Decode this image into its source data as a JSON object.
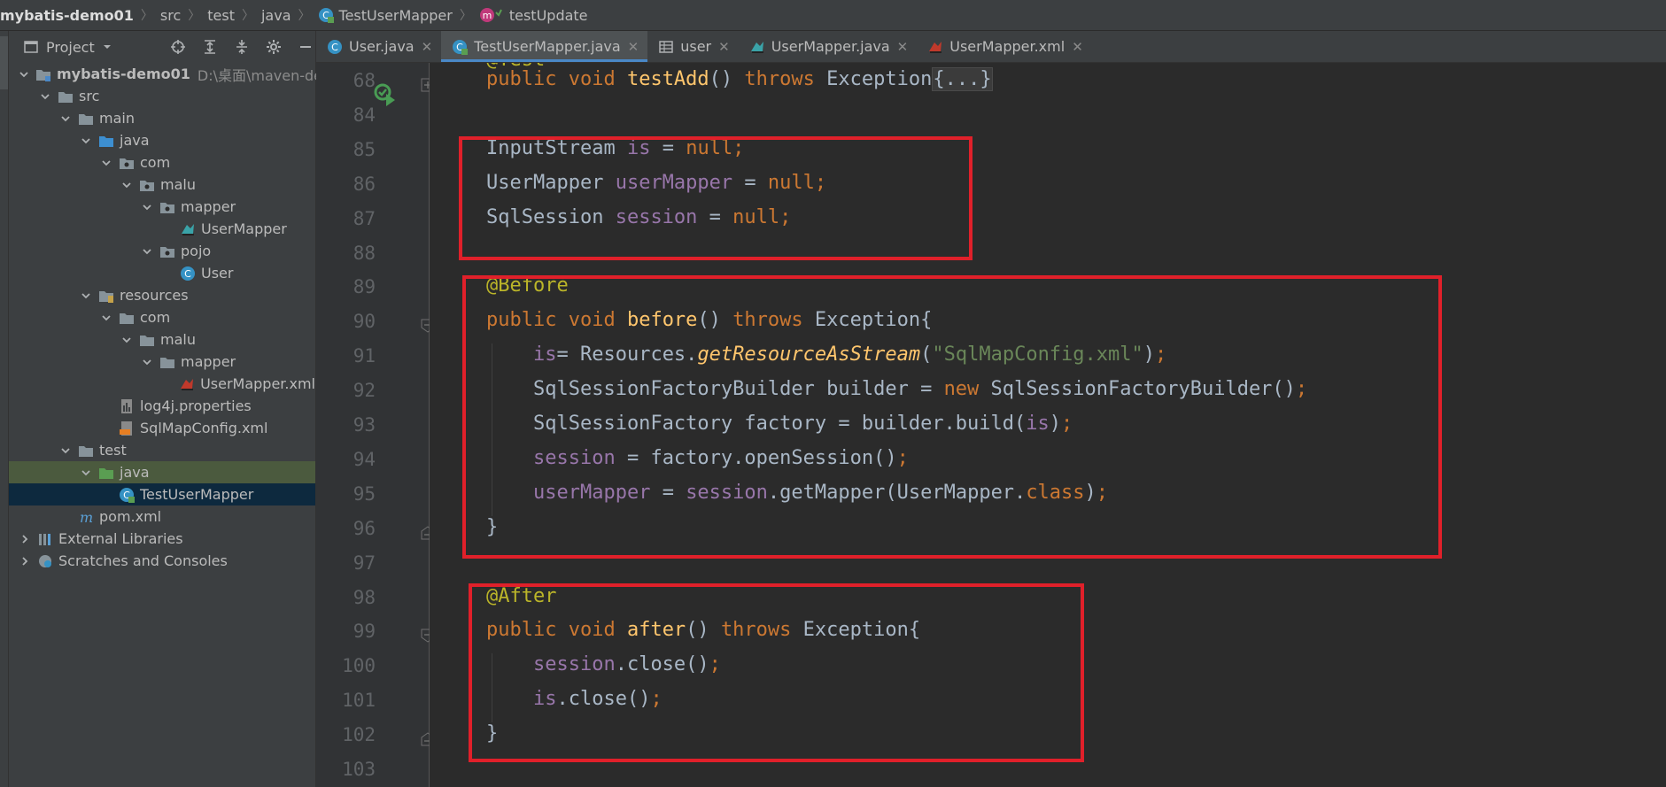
{
  "breadcrumb": {
    "items": [
      "mybatis-demo01",
      "src",
      "test",
      "java",
      "TestUserMapper",
      "testUpdate"
    ]
  },
  "project_panel": {
    "title": "Project",
    "tree": [
      {
        "label": "mybatis-demo01",
        "hint": "D:\\桌面\\maven-demo\\",
        "depth": 0,
        "arrow": "down",
        "icon": "module-folder-icon"
      },
      {
        "label": "src",
        "depth": 1,
        "arrow": "down",
        "icon": "folder-icon"
      },
      {
        "label": "main",
        "depth": 2,
        "arrow": "down",
        "icon": "folder-icon"
      },
      {
        "label": "java",
        "depth": 3,
        "arrow": "down",
        "icon": "source-folder-icon"
      },
      {
        "label": "com",
        "depth": 4,
        "arrow": "down",
        "icon": "package-icon"
      },
      {
        "label": "malu",
        "depth": 5,
        "arrow": "down",
        "icon": "package-icon"
      },
      {
        "label": "mapper",
        "depth": 6,
        "arrow": "down",
        "icon": "package-icon"
      },
      {
        "label": "UserMapper",
        "depth": 7,
        "arrow": "",
        "icon": "mybatis-interface-icon"
      },
      {
        "label": "pojo",
        "depth": 6,
        "arrow": "down",
        "icon": "package-icon"
      },
      {
        "label": "User",
        "depth": 7,
        "arrow": "",
        "icon": "class-icon"
      },
      {
        "label": "resources",
        "depth": 3,
        "arrow": "down",
        "icon": "resources-folder-icon"
      },
      {
        "label": "com",
        "depth": 4,
        "arrow": "down",
        "icon": "folder-icon"
      },
      {
        "label": "malu",
        "depth": 5,
        "arrow": "down",
        "icon": "folder-icon"
      },
      {
        "label": "mapper",
        "depth": 6,
        "arrow": "down",
        "icon": "folder-icon"
      },
      {
        "label": "UserMapper.xml",
        "depth": 7,
        "arrow": "",
        "icon": "mybatis-xml-icon"
      },
      {
        "label": "log4j.properties",
        "depth": 4,
        "arrow": "",
        "icon": "properties-file-icon"
      },
      {
        "label": "SqlMapConfig.xml",
        "depth": 4,
        "arrow": "",
        "icon": "xml-file-icon"
      },
      {
        "label": "test",
        "depth": 2,
        "arrow": "down",
        "icon": "folder-icon"
      },
      {
        "label": "java",
        "depth": 3,
        "arrow": "down",
        "icon": "test-source-folder-icon",
        "state": "hl"
      },
      {
        "label": "TestUserMapper",
        "depth": 4,
        "arrow": "",
        "icon": "test-class-icon",
        "state": "selected"
      },
      {
        "label": "pom.xml",
        "depth": 2,
        "arrow": "",
        "icon": "maven-icon"
      },
      {
        "label": "External Libraries",
        "depth": 0,
        "arrow": "right",
        "icon": "libraries-icon"
      },
      {
        "label": "Scratches and Consoles",
        "depth": 0,
        "arrow": "right",
        "icon": "scratches-icon"
      }
    ]
  },
  "tabs": [
    {
      "label": "User.java",
      "icon": "class-icon",
      "active": false
    },
    {
      "label": "TestUserMapper.java",
      "icon": "test-class-icon",
      "active": true
    },
    {
      "label": "user",
      "icon": "table-icon",
      "active": false
    },
    {
      "label": "UserMapper.java",
      "icon": "mybatis-interface-icon",
      "active": false
    },
    {
      "label": "UserMapper.xml",
      "icon": "mybatis-xml-icon",
      "active": false
    }
  ],
  "editor": {
    "top_partial": "@Test",
    "lines": [
      {
        "num": "68",
        "y": 0,
        "tokens": [
          [
            "k",
            "public void "
          ],
          [
            "m",
            "testAdd"
          ],
          [
            "",
            "() "
          ],
          [
            "k",
            "throws "
          ],
          [
            "",
            "Exception"
          ],
          [
            "ph",
            "{...}"
          ]
        ]
      },
      {
        "num": "84",
        "tokens": []
      },
      {
        "num": "85",
        "tokens": [
          [
            "",
            "InputStream "
          ],
          [
            "f",
            "is "
          ],
          [
            "",
            "= "
          ],
          [
            "k",
            "null;"
          ]
        ]
      },
      {
        "num": "86",
        "tokens": [
          [
            "",
            "UserMapper "
          ],
          [
            "f",
            "userMapper "
          ],
          [
            "",
            "= "
          ],
          [
            "k",
            "null;"
          ]
        ]
      },
      {
        "num": "87",
        "tokens": [
          [
            "",
            "SqlSession "
          ],
          [
            "f",
            "session "
          ],
          [
            "",
            "= "
          ],
          [
            "k",
            "null;"
          ]
        ]
      },
      {
        "num": "88",
        "tokens": []
      },
      {
        "num": "89",
        "tokens": [
          [
            "a",
            "@Before"
          ]
        ]
      },
      {
        "num": "90",
        "tokens": [
          [
            "k",
            "public void "
          ],
          [
            "m",
            "before"
          ],
          [
            "",
            "() "
          ],
          [
            "k",
            "throws "
          ],
          [
            "",
            "Exception{"
          ]
        ]
      },
      {
        "num": "91",
        "tokens": [
          [
            "",
            "    "
          ],
          [
            "f",
            "is"
          ],
          [
            "",
            "= Resources."
          ],
          [
            "mi",
            "getResourceAsStream"
          ],
          [
            "",
            "("
          ],
          [
            "s",
            "\"SqlMapConfig.xml\""
          ],
          [
            "",
            ")"
          ],
          [
            "k",
            ";"
          ]
        ]
      },
      {
        "num": "92",
        "tokens": [
          [
            "",
            "    SqlSessionFactoryBuilder builder = "
          ],
          [
            "k",
            "new "
          ],
          [
            "",
            "SqlSessionFactoryBuilder()"
          ],
          [
            "k",
            ";"
          ]
        ]
      },
      {
        "num": "93",
        "tokens": [
          [
            "",
            "    SqlSessionFactory factory = builder.build("
          ],
          [
            "f",
            "is"
          ],
          [
            "",
            ")"
          ],
          [
            "k",
            ";"
          ]
        ]
      },
      {
        "num": "94",
        "tokens": [
          [
            "",
            "    "
          ],
          [
            "f",
            "session "
          ],
          [
            "",
            "= factory.openSession()"
          ],
          [
            "k",
            ";"
          ]
        ]
      },
      {
        "num": "95",
        "tokens": [
          [
            "",
            "    "
          ],
          [
            "f",
            "userMapper "
          ],
          [
            "",
            "= "
          ],
          [
            "f",
            "session"
          ],
          [
            "",
            ".getMapper(UserMapper."
          ],
          [
            "k",
            "class"
          ],
          [
            "",
            ")"
          ],
          [
            "k",
            ";"
          ]
        ]
      },
      {
        "num": "96",
        "tokens": [
          [
            "",
            "}"
          ]
        ]
      },
      {
        "num": "97",
        "tokens": []
      },
      {
        "num": "98",
        "tokens": [
          [
            "a",
            "@After"
          ]
        ]
      },
      {
        "num": "99",
        "tokens": [
          [
            "k",
            "public void "
          ],
          [
            "m",
            "after"
          ],
          [
            "",
            "() "
          ],
          [
            "k",
            "throws "
          ],
          [
            "",
            "Exception{"
          ]
        ]
      },
      {
        "num": "100",
        "tokens": [
          [
            "",
            "    "
          ],
          [
            "f",
            "session"
          ],
          [
            "",
            ".close()"
          ],
          [
            "k",
            ";"
          ]
        ]
      },
      {
        "num": "101",
        "tokens": [
          [
            "",
            "    "
          ],
          [
            "f",
            "is"
          ],
          [
            "",
            ".close()"
          ],
          [
            "k",
            ";"
          ]
        ]
      },
      {
        "num": "102",
        "tokens": [
          [
            "",
            "}"
          ]
        ]
      },
      {
        "num": "103",
        "tokens": []
      }
    ]
  },
  "colors": {
    "highlight_box": "#e0202a",
    "keyword": "#cc7832",
    "method": "#ffc66d",
    "field": "#9876aa",
    "string": "#6a8759",
    "annotation": "#bbb529"
  }
}
